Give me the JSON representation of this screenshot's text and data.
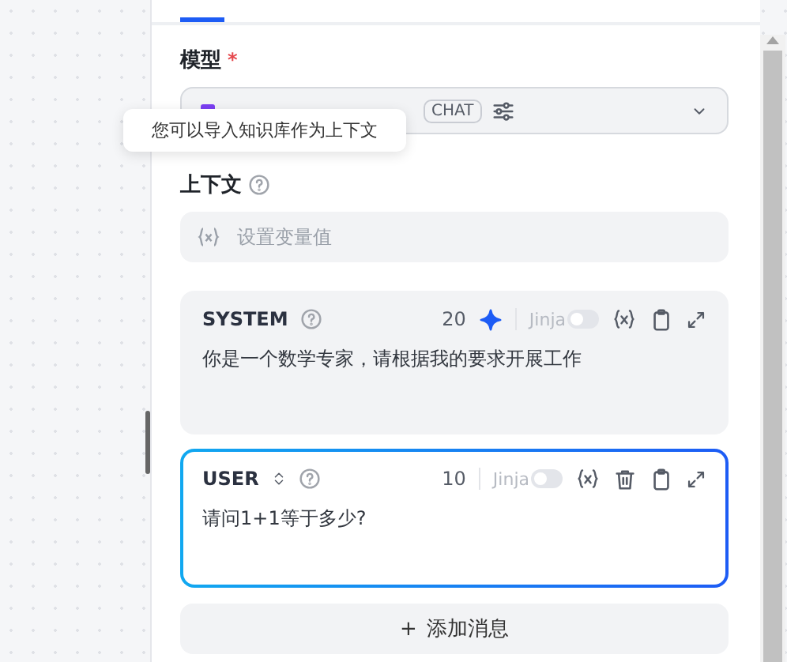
{
  "model": {
    "label": "模型",
    "required_mark": "*",
    "badge": "CHAT"
  },
  "tooltip": {
    "text": "您可以导入知识库作为上下文"
  },
  "context": {
    "label": "上下文",
    "placeholder": "设置变量值"
  },
  "messages": [
    {
      "role": "SYSTEM",
      "kind": "system",
      "count": "20",
      "jinja_label": "Jinja",
      "jinja_on": false,
      "text": "你是一个数学专家，请根据我的要求开展工作",
      "focused": false
    },
    {
      "role": "USER",
      "kind": "user",
      "count": "10",
      "jinja_label": "Jinja",
      "jinja_on": false,
      "text": "请问1+1等于多少?",
      "focused": true
    }
  ],
  "add_button": {
    "icon": "+",
    "label": "添加消息"
  }
}
